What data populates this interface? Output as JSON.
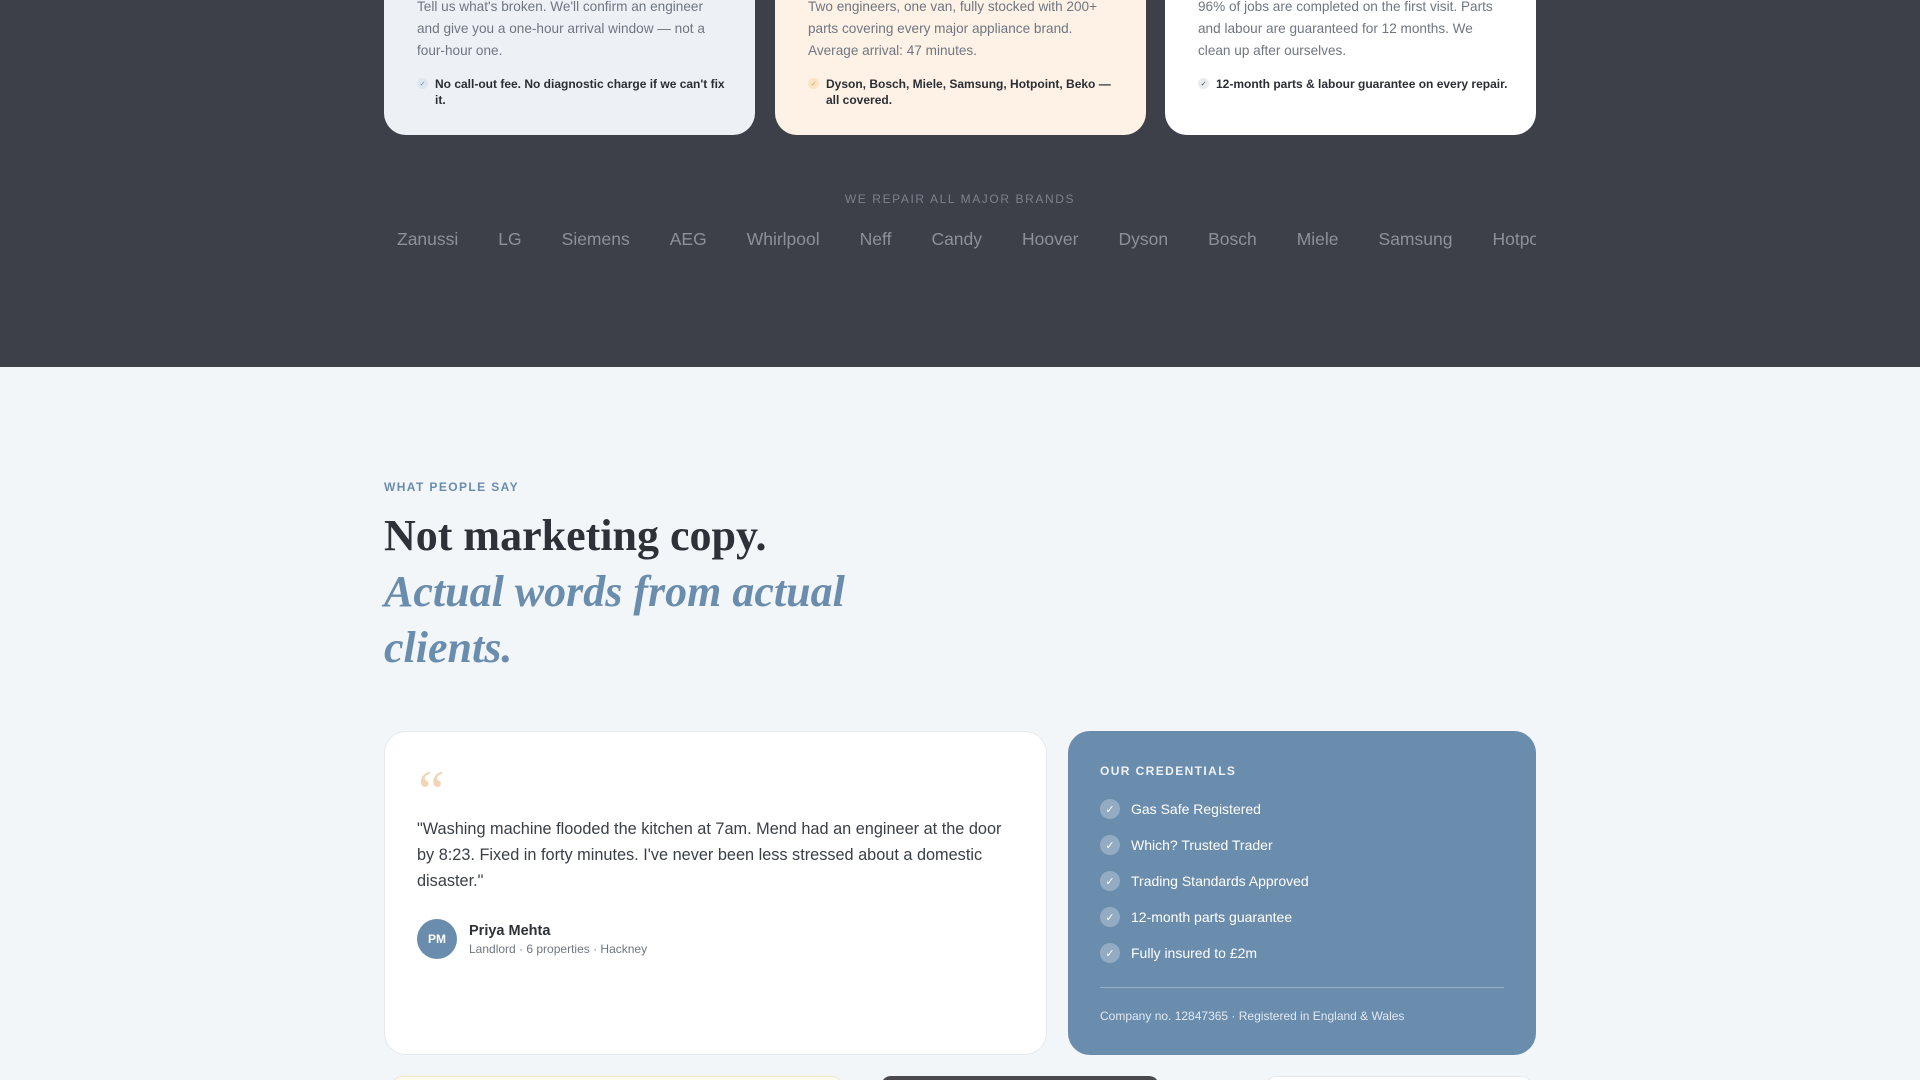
{
  "features": {
    "cards": [
      {
        "text": "Tell us what's broken. We'll confirm an engineer and give you a one-hour arrival window — not a four-hour one.",
        "check": "No call-out fee. No diagnostic charge if we can't fix it."
      },
      {
        "text": "Two engineers, one van, fully stocked with 200+ parts covering every major appliance brand. Average arrival: 47 minutes.",
        "check": "Dyson, Bosch, Miele, Samsung, Hotpoint, Beko — all covered."
      },
      {
        "text": "96% of jobs are completed on the first visit. Parts and labour are guaranteed for 12 months. We clean up after ourselves.",
        "check": "12-month parts & labour guarantee on every repair."
      }
    ]
  },
  "brands": {
    "heading": "WE REPAIR ALL MAJOR BRANDS",
    "items": [
      "Zanussi",
      "LG",
      "Siemens",
      "AEG",
      "Whirlpool",
      "Neff",
      "Candy",
      "Hoover",
      "Dyson",
      "Bosch",
      "Miele",
      "Samsung",
      "Hotpoint"
    ]
  },
  "testimonials": {
    "eyebrow": "WHAT PEOPLE SAY",
    "headline": "Not marketing copy.",
    "headline_italic": "Actual words from actual clients.",
    "quote_mark": "“",
    "quote": "\"Washing machine flooded the kitchen at 7am. Mend had an engineer at the door by 8:23. Fixed in forty minutes. I've never been less stressed about a domestic disaster.\"",
    "author": {
      "initials": "PM",
      "name": "Priya Mehta",
      "meta": "Landlord · 6 properties · Hackney"
    }
  },
  "credentials": {
    "title": "OUR CREDENTIALS",
    "items": [
      "Gas Safe Registered",
      "Which? Trusted Trader",
      "Trading Standards Approved",
      "12-month parts guarantee",
      "Fully insured to £2m"
    ],
    "footer": "Company no. 12847365 · Registered in England & Wales"
  },
  "icons": {
    "check": "✓"
  },
  "colors": {
    "dark_bg": "#3d4049",
    "accent_blue": "#6a8cad",
    "accent_peach": "#fdf2e5",
    "page_bg": "#f3f6f9"
  }
}
